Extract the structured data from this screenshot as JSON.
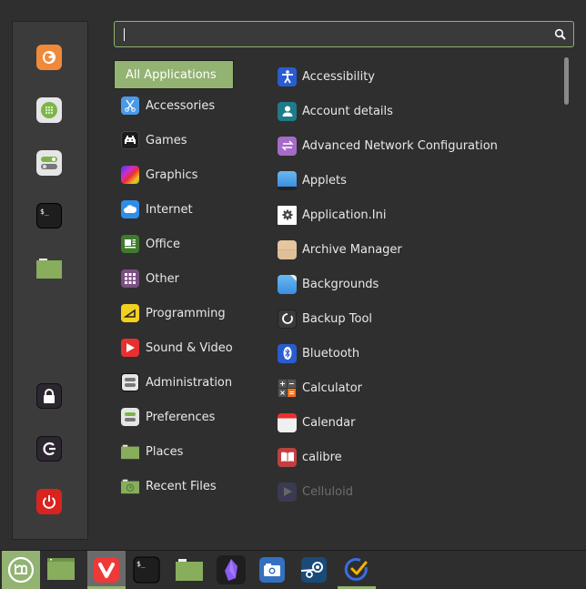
{
  "search": {
    "value": "",
    "placeholder": "",
    "icon": "search-icon"
  },
  "favorites": [
    {
      "name": "Firefox",
      "icon": "firefox-icon"
    },
    {
      "name": "Software Manager",
      "icon": "software-manager-icon"
    },
    {
      "name": "System Settings",
      "icon": "system-settings-icon"
    },
    {
      "name": "Terminal",
      "icon": "terminal-icon"
    },
    {
      "name": "Files",
      "icon": "folder-icon"
    }
  ],
  "session": [
    {
      "name": "Lock Screen",
      "icon": "lock-icon"
    },
    {
      "name": "Logout",
      "icon": "logout-icon"
    },
    {
      "name": "Quit",
      "icon": "power-icon"
    }
  ],
  "categories": [
    {
      "label": "All Applications",
      "icon": ""
    },
    {
      "label": "Accessories",
      "icon": "scissors-icon"
    },
    {
      "label": "Games",
      "icon": "invader-icon"
    },
    {
      "label": "Graphics",
      "icon": "graphics-icon"
    },
    {
      "label": "Internet",
      "icon": "cloud-icon"
    },
    {
      "label": "Office",
      "icon": "office-icon"
    },
    {
      "label": "Other",
      "icon": "grid-icon"
    },
    {
      "label": "Programming",
      "icon": "programming-icon"
    },
    {
      "label": "Sound & Video",
      "icon": "play-icon"
    },
    {
      "label": "Administration",
      "icon": "toggles-icon"
    },
    {
      "label": "Preferences",
      "icon": "preferences-icon"
    },
    {
      "label": "Places",
      "icon": "folder-icon"
    },
    {
      "label": "Recent Files",
      "icon": "recent-folder-icon"
    }
  ],
  "apps": [
    {
      "label": "Accessibility",
      "icon": "accessibility-icon"
    },
    {
      "label": "Account details",
      "icon": "user-icon"
    },
    {
      "label": "Advanced Network Configuration",
      "icon": "network-icon"
    },
    {
      "label": "Applets",
      "icon": "applets-icon"
    },
    {
      "label": "Application.Ini",
      "icon": "gear-icon"
    },
    {
      "label": "Archive Manager",
      "icon": "archive-icon"
    },
    {
      "label": "Backgrounds",
      "icon": "backgrounds-icon"
    },
    {
      "label": "Backup Tool",
      "icon": "backup-icon"
    },
    {
      "label": "Bluetooth",
      "icon": "bluetooth-icon"
    },
    {
      "label": "Calculator",
      "icon": "calculator-icon"
    },
    {
      "label": "Calendar",
      "icon": "calendar-icon"
    },
    {
      "label": "calibre",
      "icon": "book-icon"
    },
    {
      "label": "Celluloid",
      "icon": "celluloid-icon",
      "dimmed": true
    }
  ],
  "taskbar": [
    {
      "name": "Menu",
      "icon": "mint-logo-icon",
      "active": true
    },
    {
      "name": "Show Desktop",
      "icon": "desktop-icon"
    },
    {
      "name": "Vivaldi",
      "icon": "vivaldi-icon",
      "running": true
    },
    {
      "name": "Terminal",
      "icon": "terminal-icon"
    },
    {
      "name": "Files",
      "icon": "folder-icon"
    },
    {
      "name": "Obsidian",
      "icon": "obsidian-icon"
    },
    {
      "name": "Screenshot",
      "icon": "camera-icon"
    },
    {
      "name": "Steam",
      "icon": "steam-icon"
    },
    {
      "name": "Tasks",
      "icon": "tasks-icon",
      "running": true
    }
  ],
  "colors": {
    "accent": "#92b372",
    "background": "#2f2f2f",
    "sidebar": "#3b3b3b"
  }
}
